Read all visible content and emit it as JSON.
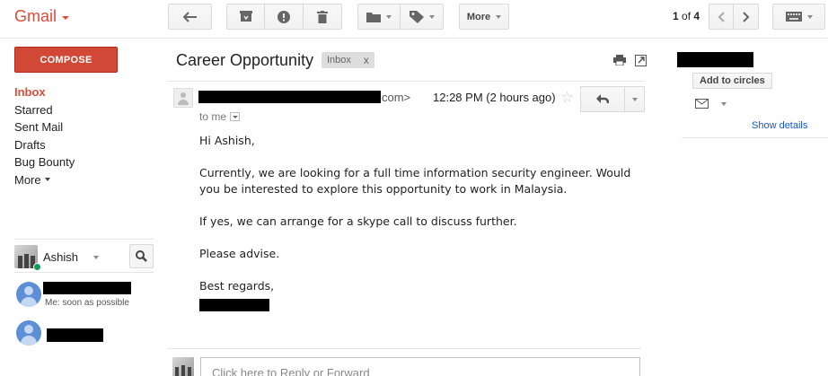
{
  "app": {
    "logo": "Gmail"
  },
  "toolbar": {
    "back_icon": "back-arrow-icon",
    "archive_icon": "archive-icon",
    "spam_icon": "report-spam-icon",
    "delete_icon": "trash-icon",
    "move_icon": "folder-icon",
    "labels_icon": "label-tag-icon",
    "more_label": "More",
    "pager": {
      "current": "1",
      "of_text": "of",
      "total": "4"
    },
    "keyboard_icon": "keyboard-icon"
  },
  "sidebar": {
    "compose_label": "COMPOSE",
    "items": [
      {
        "label": "Inbox",
        "active": true
      },
      {
        "label": "Starred"
      },
      {
        "label": "Sent Mail"
      },
      {
        "label": "Drafts"
      },
      {
        "label": "Bug Bounty"
      },
      {
        "label": "More"
      }
    ]
  },
  "chat": {
    "user_name": "Ashish",
    "status": "online",
    "contacts": [
      {
        "name": "[redacted]",
        "snippet": "Me: soon as possible"
      },
      {
        "name": "[redacted]",
        "snippet": ""
      }
    ]
  },
  "message": {
    "subject": "Career Opportunity",
    "label": "Inbox",
    "label_close": "x",
    "sender_visible_tail": "com>",
    "time": "12:28 PM (2 hours ago)",
    "to_line": "to me",
    "body": [
      "Hi Ashish,",
      "Currently, we are looking for a full time information security engineer. Would",
      "you be interested to explore this opportunity to work in Malaysia.",
      "If yes, we can arrange for a skype call to discuss further.",
      "Please advise.",
      "Best regards,"
    ],
    "reply_placeholder": "Click here to Reply or Forward"
  },
  "right_panel": {
    "add_to_circles": "Add to circles",
    "show_details": "Show details"
  }
}
